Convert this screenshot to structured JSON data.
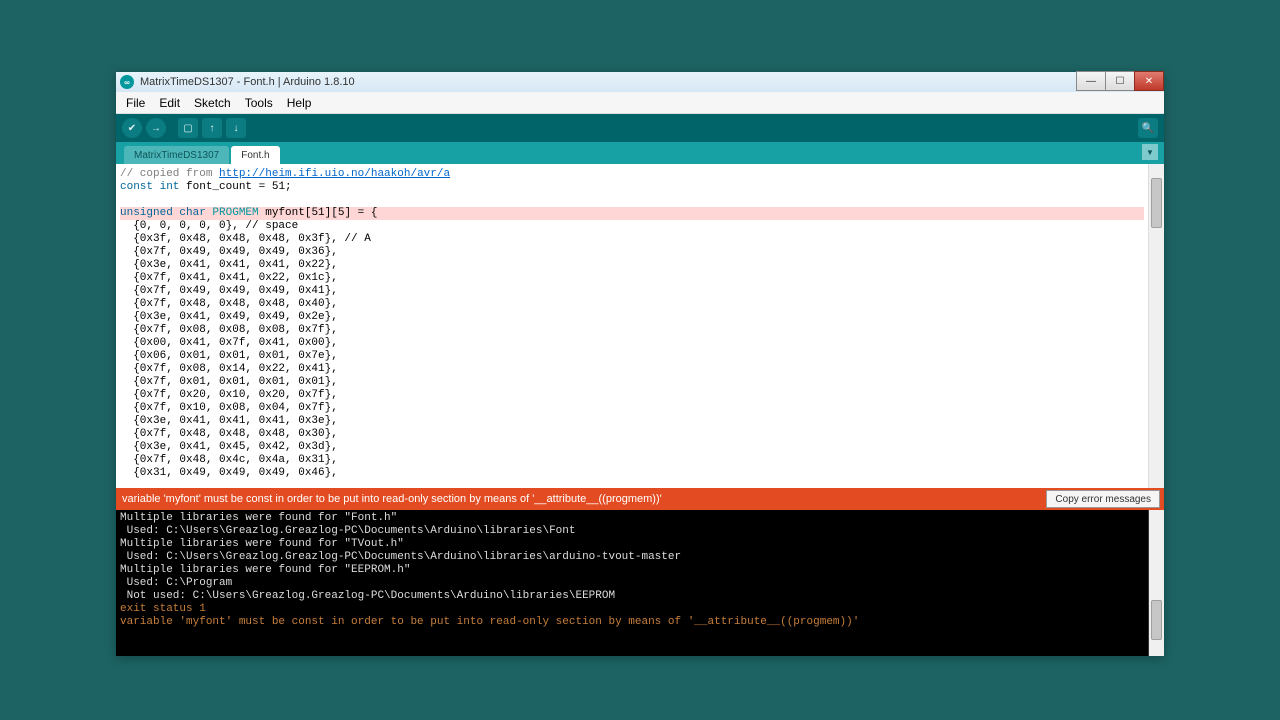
{
  "window": {
    "title": "MatrixTimeDS1307 - Font.h | Arduino 1.8.10"
  },
  "menubar": {
    "file": "File",
    "edit": "Edit",
    "sketch": "Sketch",
    "tools": "Tools",
    "help": "Help"
  },
  "tabs": {
    "t0": "MatrixTimeDS1307",
    "t1": "Font.h"
  },
  "editor": {
    "l0_a": "// copied from ",
    "l0_b": "http://heim.ifi.uio.no/haakoh/avr/a",
    "l1_a": "const int",
    "l1_b": " font_count = 51;",
    "l3_a": "unsigned char ",
    "l3_b": "PROGMEM",
    "l3_c": " myfont[51][5] = {",
    "l4": "  {0, 0, 0, 0, 0}, // space",
    "l5": "  {0x3f, 0x48, 0x48, 0x48, 0x3f}, // A",
    "l6": "  {0x7f, 0x49, 0x49, 0x49, 0x36},",
    "l7": "  {0x3e, 0x41, 0x41, 0x41, 0x22},",
    "l8": "  {0x7f, 0x41, 0x41, 0x22, 0x1c},",
    "l9": "  {0x7f, 0x49, 0x49, 0x49, 0x41},",
    "l10": "  {0x7f, 0x48, 0x48, 0x48, 0x40},",
    "l11": "  {0x3e, 0x41, 0x49, 0x49, 0x2e},",
    "l12": "  {0x7f, 0x08, 0x08, 0x08, 0x7f},",
    "l13": "  {0x00, 0x41, 0x7f, 0x41, 0x00},",
    "l14": "  {0x06, 0x01, 0x01, 0x01, 0x7e},",
    "l15": "  {0x7f, 0x08, 0x14, 0x22, 0x41},",
    "l16": "  {0x7f, 0x01, 0x01, 0x01, 0x01},",
    "l17": "  {0x7f, 0x20, 0x10, 0x20, 0x7f},",
    "l18": "  {0x7f, 0x10, 0x08, 0x04, 0x7f},",
    "l19": "  {0x3e, 0x41, 0x41, 0x41, 0x3e},",
    "l20": "  {0x7f, 0x48, 0x48, 0x48, 0x30},",
    "l21": "  {0x3e, 0x41, 0x45, 0x42, 0x3d},",
    "l22": "  {0x7f, 0x48, 0x4c, 0x4a, 0x31},",
    "l23": "  {0x31, 0x49, 0x49, 0x49, 0x46},"
  },
  "errorbar": {
    "message": "variable 'myfont' must be const in order to be put into read-only section by means of '__attribute__((progmem))'",
    "copy_label": "Copy error messages"
  },
  "console": {
    "c0": "Multiple libraries were found for \"Font.h\"",
    "c1": " Used: C:\\Users\\Greazlog.Greazlog-PC\\Documents\\Arduino\\libraries\\Font",
    "c2": "Multiple libraries were found for \"TVout.h\"",
    "c3": " Used: C:\\Users\\Greazlog.Greazlog-PC\\Documents\\Arduino\\libraries\\arduino-tvout-master",
    "c4": "Multiple libraries were found for \"EEPROM.h\"",
    "c5": " Used: C:\\Program",
    "c6": " Not used: C:\\Users\\Greazlog.Greazlog-PC\\Documents\\Arduino\\libraries\\EEPROM",
    "c7": "exit status 1",
    "c8": "variable 'myfont' must be const in order to be put into read-only section by means of '__attribute__((progmem))'"
  }
}
